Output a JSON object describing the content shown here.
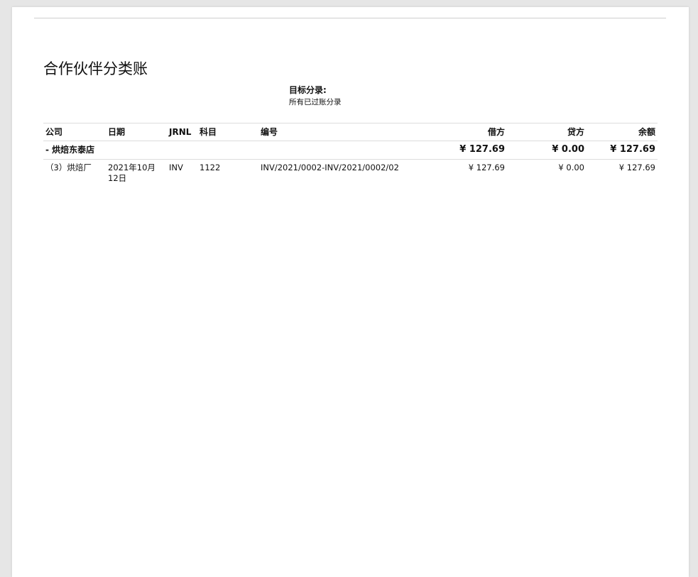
{
  "report": {
    "title": "合作伙伴分类账",
    "filter_label": "目标分录:",
    "filter_value": "所有已过账分录"
  },
  "table": {
    "headers": {
      "company": "公司",
      "date": "日期",
      "jrnl": "JRNL",
      "account": "科目",
      "ref": "编号",
      "debit": "借方",
      "credit": "贷方",
      "balance": "余额"
    },
    "groups": [
      {
        "partner": "- 烘焙东泰店",
        "debit": "¥ 127.69",
        "credit": "¥ 0.00",
        "balance": "¥ 127.69",
        "lines": [
          {
            "company": "（3）烘焙厂",
            "date": "2021年10月12日",
            "jrnl": "INV",
            "account": "1122",
            "ref": "INV/2021/0002-INV/2021/0002/02",
            "debit": "¥ 127.69",
            "credit": "¥ 0.00",
            "balance": "¥ 127.69"
          }
        ]
      }
    ]
  }
}
